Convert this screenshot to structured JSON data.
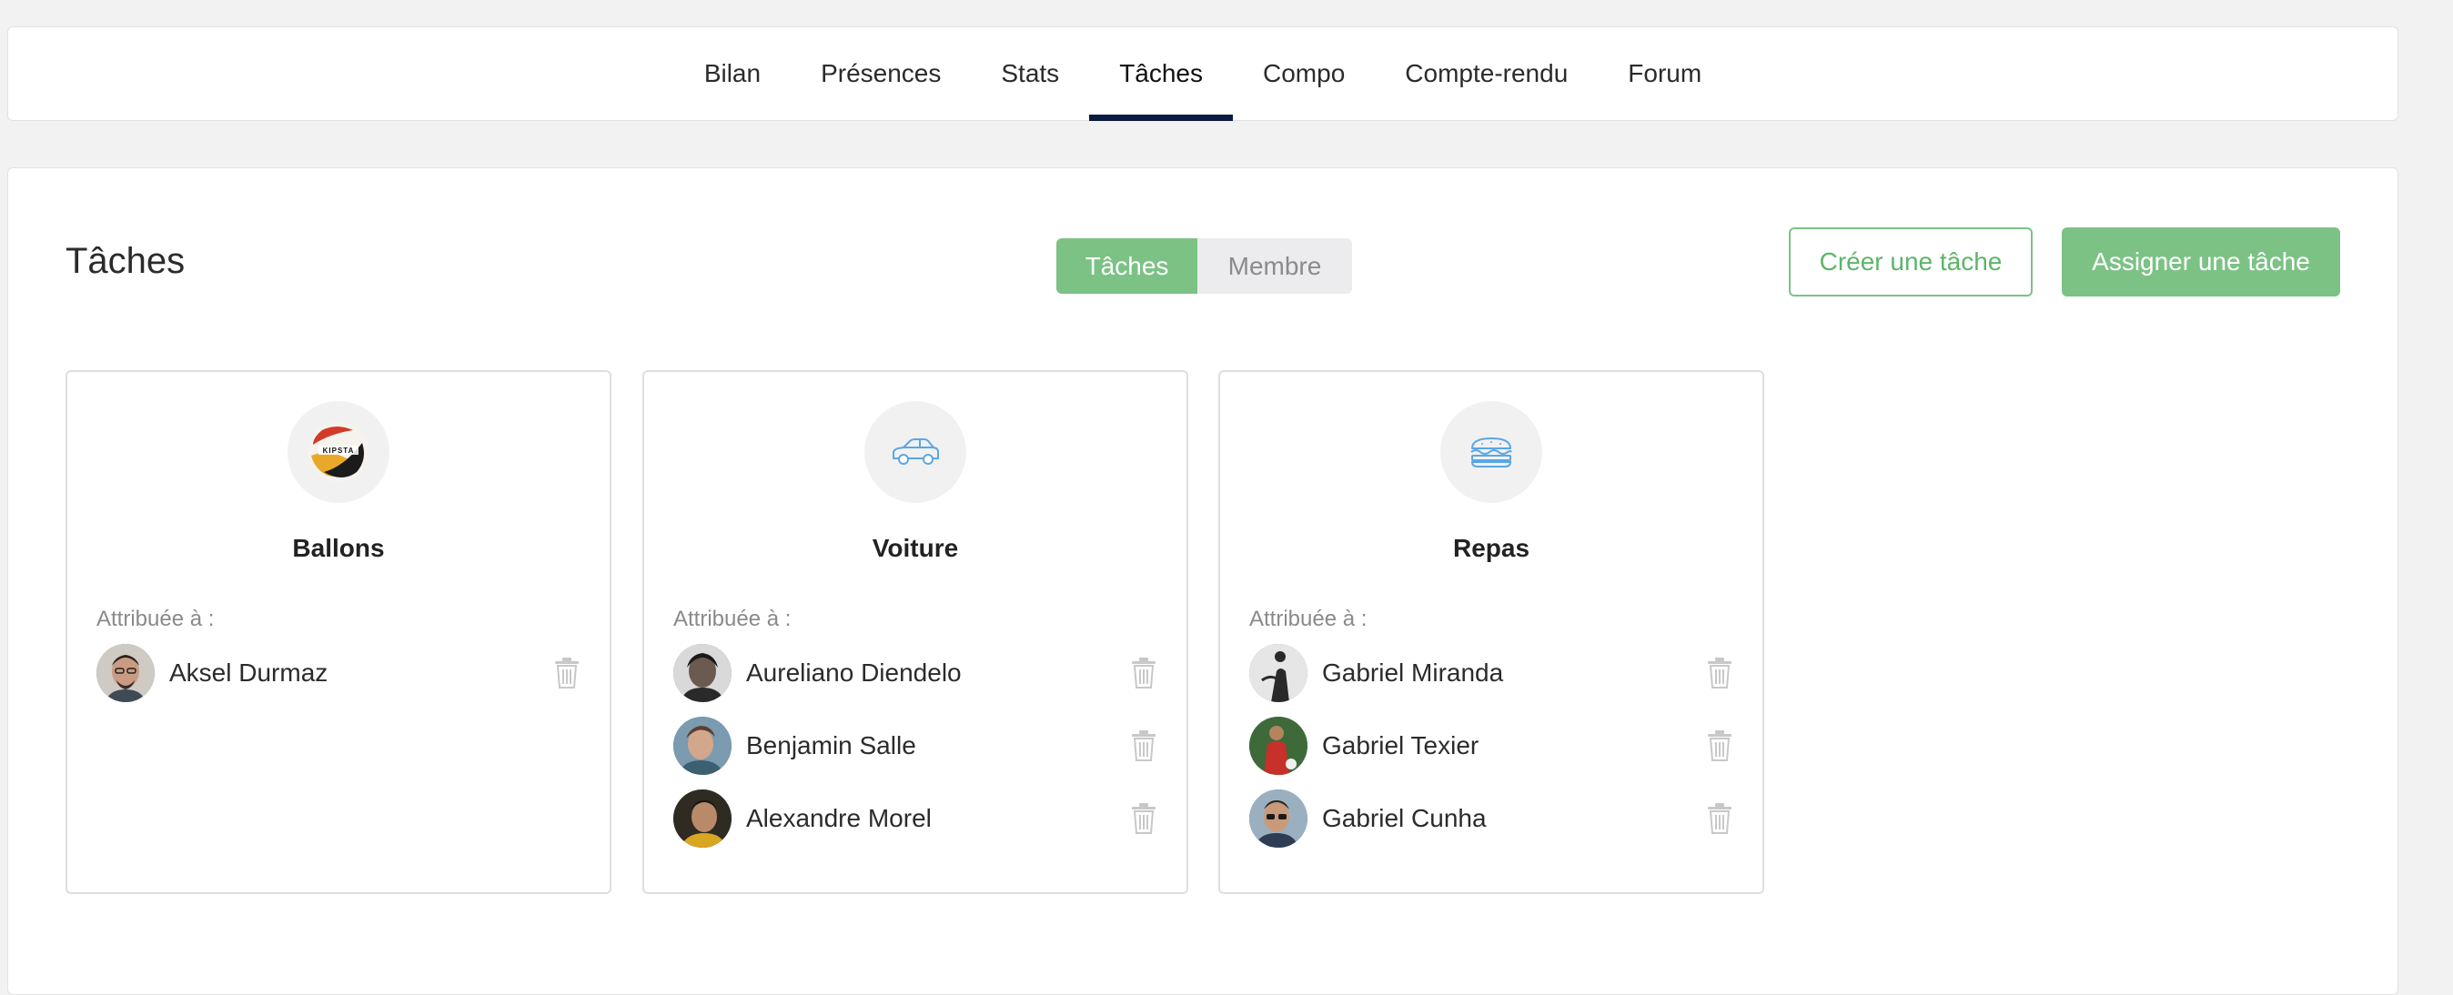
{
  "nav": {
    "tabs": [
      {
        "label": "Bilan",
        "active": false
      },
      {
        "label": "Présences",
        "active": false
      },
      {
        "label": "Stats",
        "active": false
      },
      {
        "label": "Tâches",
        "active": true
      },
      {
        "label": "Compo",
        "active": false
      },
      {
        "label": "Compte-rendu",
        "active": false
      },
      {
        "label": "Forum",
        "active": false
      }
    ]
  },
  "page": {
    "title": "Tâches",
    "view_toggle": {
      "tasks_label": "Tâches",
      "member_label": "Membre",
      "selected": "Tâches"
    },
    "create_button": "Créer une tâche",
    "assign_button": "Assigner une tâche"
  },
  "colors": {
    "accent": "#7cc285",
    "tab_underline": "#0a1b3f",
    "icon_blue": "#5aa6e6"
  },
  "tasks": [
    {
      "name": "Ballons",
      "icon": "kipsta-ball-logo",
      "assigned_label": "Attribuée à :",
      "assignees": [
        {
          "name": "Aksel Durmaz"
        }
      ]
    },
    {
      "name": "Voiture",
      "icon": "car-icon",
      "assigned_label": "Attribuée à :",
      "assignees": [
        {
          "name": "Aureliano Diendelo"
        },
        {
          "name": "Benjamin Salle"
        },
        {
          "name": "Alexandre Morel"
        }
      ]
    },
    {
      "name": "Repas",
      "icon": "sandwich-icon",
      "assigned_label": "Attribuée à :",
      "assignees": [
        {
          "name": "Gabriel Miranda"
        },
        {
          "name": "Gabriel Texier"
        },
        {
          "name": "Gabriel Cunha"
        }
      ]
    }
  ]
}
